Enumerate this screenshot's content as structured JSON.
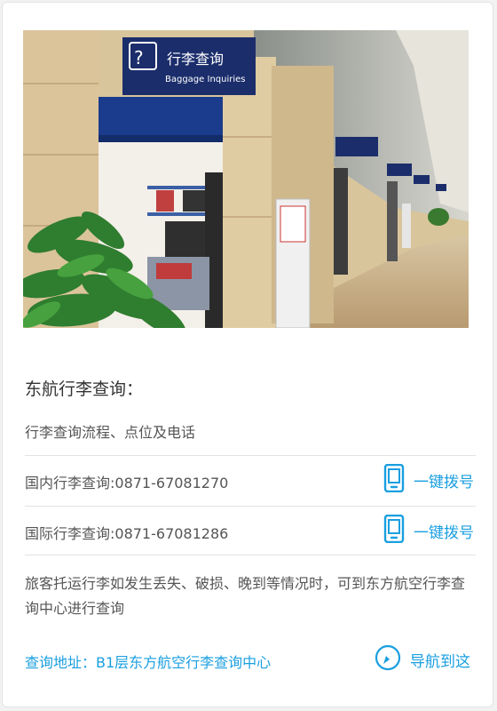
{
  "photo": {
    "alt": "Baggage inquiries counter in airport terminal",
    "sign_cn": "行李查询",
    "sign_en": "Baggage Inquiries"
  },
  "section": {
    "title": "东航行李查询：",
    "subtitle": "行李查询流程、点位及电话"
  },
  "phones": [
    {
      "text": "国内行李查询:0871-67081270",
      "action_label": "一键拨号",
      "icon": "phone-icon"
    },
    {
      "text": "国际行李查询:0871-67081286",
      "action_label": "一键拨号",
      "icon": "phone-icon"
    }
  ],
  "description": "旅客托运行李如发生丢失、破损、晚到等情况时，可到东方航空行李查询中心进行查询",
  "address": {
    "text": "查询地址：B1层东方航空行李查询中心",
    "action_label": "导航到这",
    "icon": "compass-icon"
  },
  "colors": {
    "accent": "#1a9fe0",
    "text": "#555555"
  }
}
